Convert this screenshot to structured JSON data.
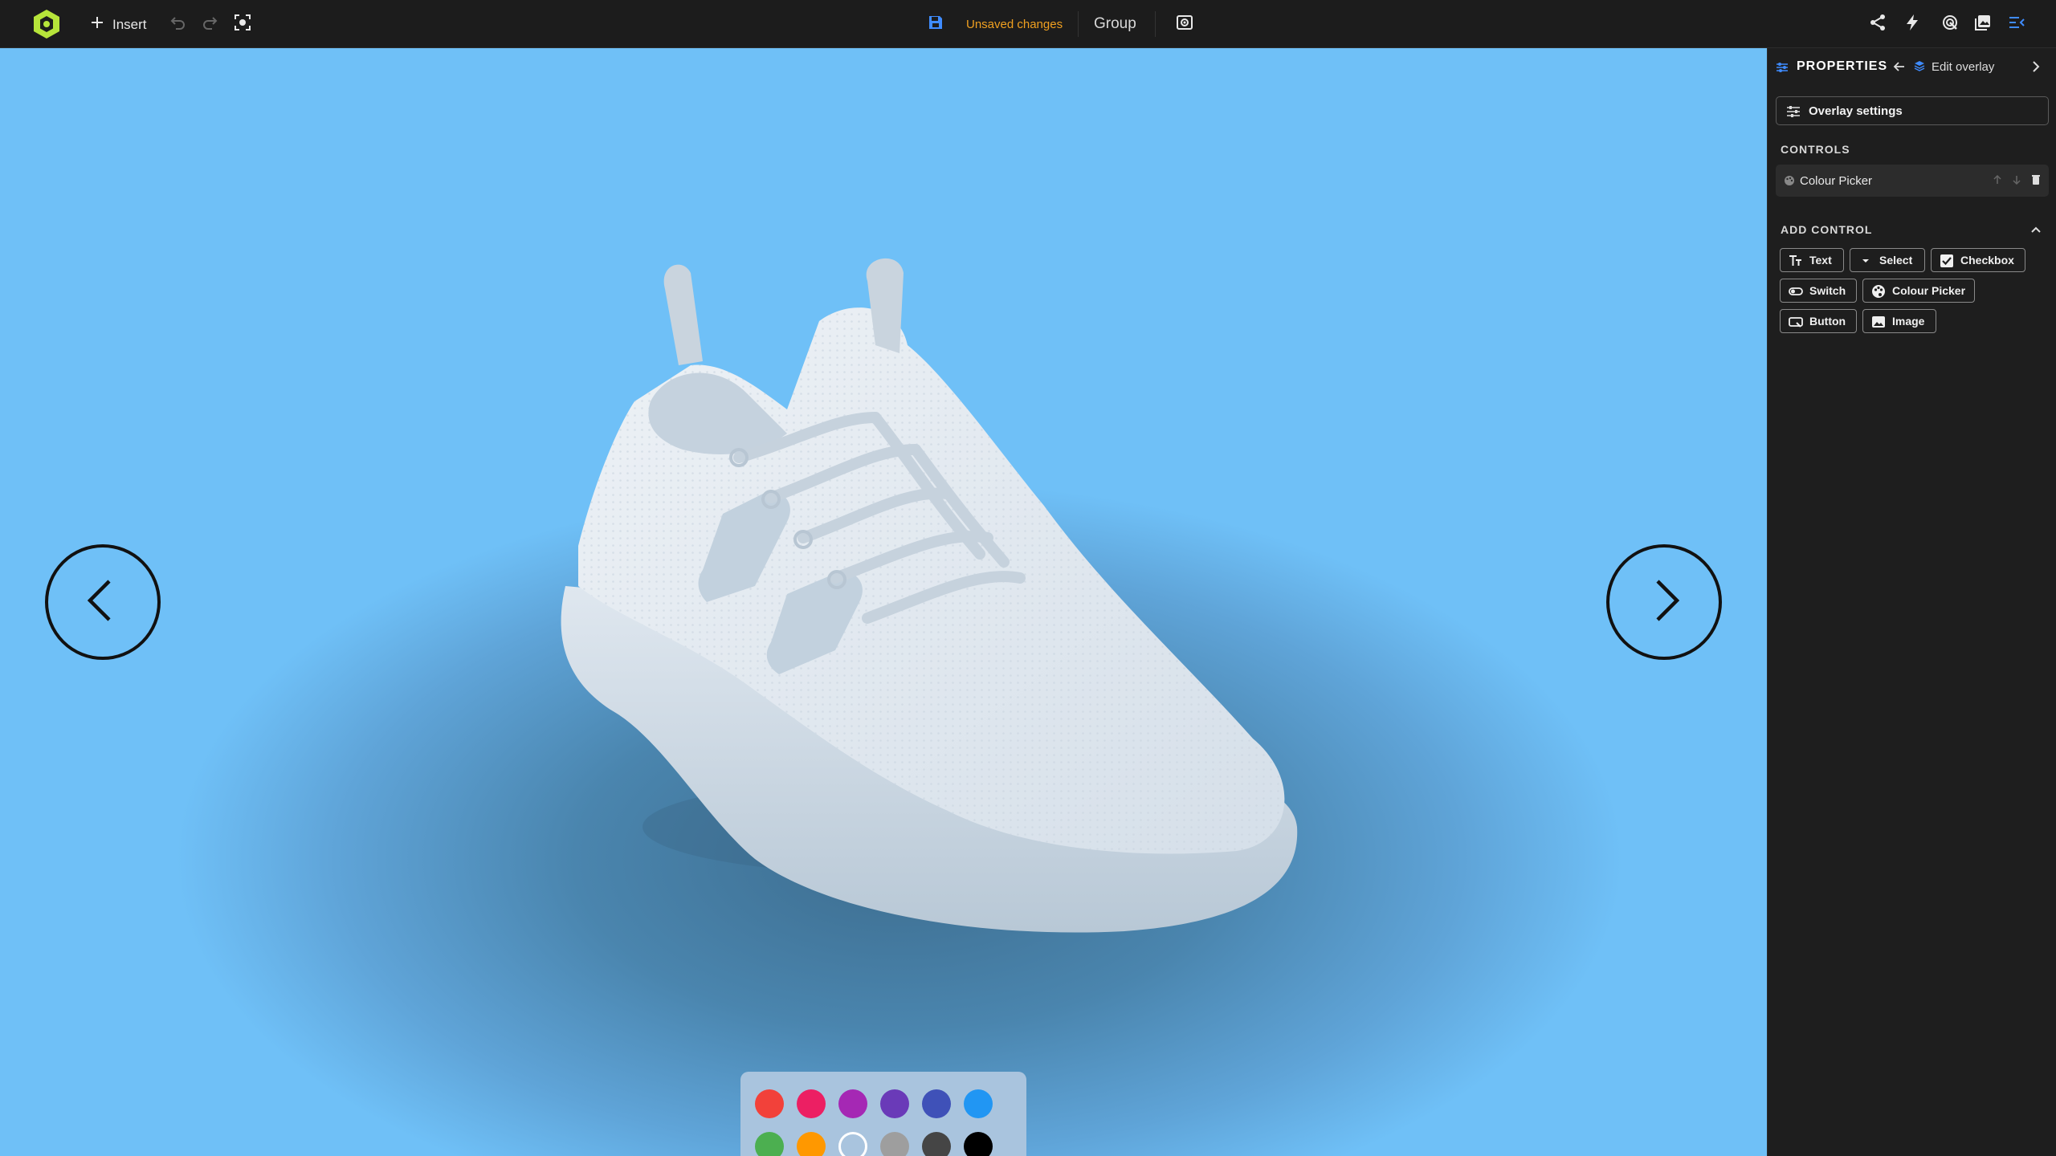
{
  "toolbar": {
    "insert_label": "Insert",
    "unsaved_label": "Unsaved changes",
    "group_label": "Group"
  },
  "canvas": {
    "swatches": [
      {
        "color": "#f2413a",
        "selected": false
      },
      {
        "color": "#ec1f63",
        "selected": false
      },
      {
        "color": "#a528b4",
        "selected": false
      },
      {
        "color": "#6a3ab8",
        "selected": false
      },
      {
        "color": "#3f51b8",
        "selected": false
      },
      {
        "color": "#2196f3",
        "selected": false
      },
      {
        "color": "#4caf50",
        "selected": false
      },
      {
        "color": "#ff9800",
        "selected": false
      },
      {
        "color": "#ffffff",
        "selected": true
      },
      {
        "color": "#9e9e9e",
        "selected": false
      },
      {
        "color": "#454545",
        "selected": false
      },
      {
        "color": "#000000",
        "selected": false
      }
    ]
  },
  "sidebar": {
    "title": "PROPERTIES",
    "edit_overlay_label": "Edit overlay",
    "overlay_settings_label": "Overlay settings",
    "controls_title": "CONTROLS",
    "control_item": "Colour Picker",
    "add_control_title": "ADD CONTROL",
    "add_controls": {
      "text": "Text",
      "select": "Select",
      "checkbox": "Checkbox",
      "switch": "Switch",
      "colour_picker": "Colour Picker",
      "button": "Button",
      "image": "Image"
    }
  },
  "colors": {
    "brand": "#b6e43a",
    "accent": "#3f8cff",
    "warning": "#f0a020"
  }
}
